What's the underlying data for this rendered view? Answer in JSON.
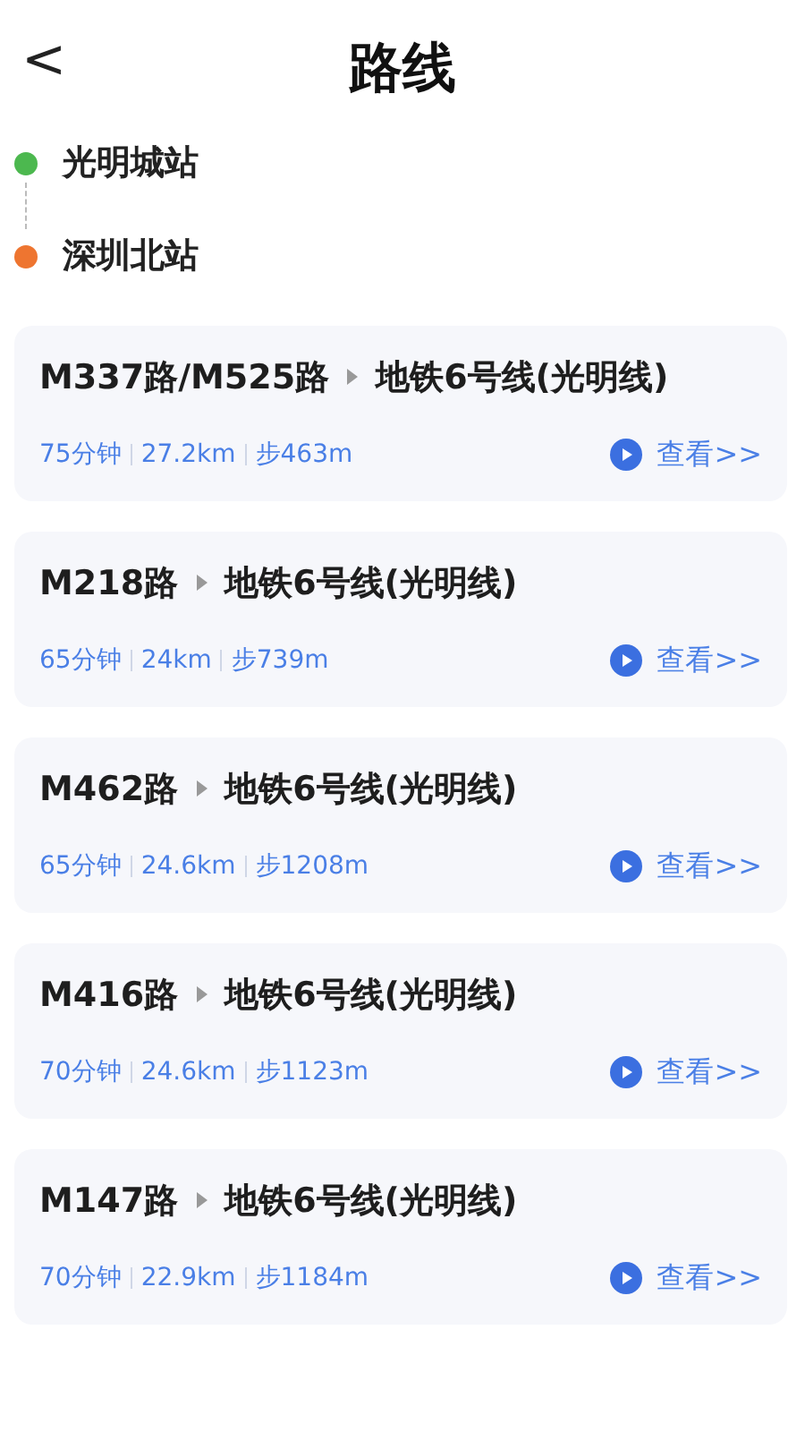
{
  "header": {
    "back": "<",
    "title": "路线"
  },
  "stations": [
    {
      "name": "光明城站",
      "color": "#4cb84f"
    },
    {
      "name": "深圳北站",
      "color": "#ee7530"
    }
  ],
  "routes": [
    {
      "legs": [
        "M337路/M525路",
        "地铁6号线(光明线)"
      ],
      "stats": [
        "75分钟",
        "27.2km",
        "步463m"
      ],
      "action": "查看>>"
    },
    {
      "legs": [
        "M218路",
        "地铁6号线(光明线)"
      ],
      "stats": [
        "65分钟",
        "24km",
        "步739m"
      ],
      "action": "查看>>"
    },
    {
      "legs": [
        "M462路",
        "地铁6号线(光明线)"
      ],
      "stats": [
        "65分钟",
        "24.6km",
        "步1208m"
      ],
      "action": "查看>>"
    },
    {
      "legs": [
        "M416路",
        "地铁6号线(光明线)"
      ],
      "stats": [
        "70分钟",
        "24.6km",
        "步1123m"
      ],
      "action": "查看>>"
    },
    {
      "legs": [
        "M147路",
        "地铁6号线(光明线)"
      ],
      "stats": [
        "70分钟",
        "22.9km",
        "步1184m"
      ],
      "action": "查看>>"
    }
  ]
}
